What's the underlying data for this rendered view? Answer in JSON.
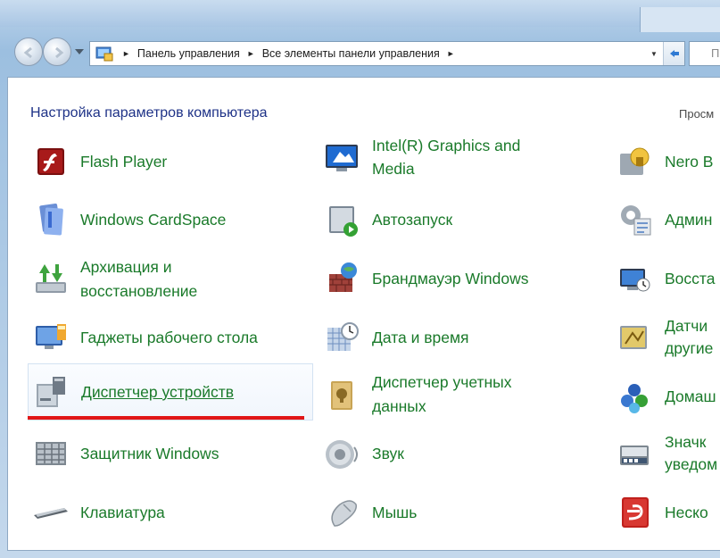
{
  "window": {
    "address": {
      "crumbs": [
        "Панель управления",
        "Все элементы панели управления"
      ],
      "search_placeholder": "П"
    }
  },
  "content": {
    "heading": "Настройка параметров компьютера",
    "view_label": "Просм"
  },
  "items": {
    "col1": [
      {
        "label": "Flash Player",
        "icon": "flash-icon"
      },
      {
        "label": "Windows CardSpace",
        "icon": "cardspace-icon"
      },
      {
        "label": "Архивация и\nвосстановление",
        "icon": "backup-icon"
      },
      {
        "label": "Гаджеты рабочего стола",
        "icon": "gadgets-icon"
      },
      {
        "label": "Диспетчер устройств",
        "icon": "device-manager-icon"
      },
      {
        "label": "Защитник Windows",
        "icon": "defender-icon"
      },
      {
        "label": "Клавиатура",
        "icon": "keyboard-icon"
      }
    ],
    "col2": [
      {
        "label": "Intel(R) Graphics and\nMedia",
        "icon": "intel-graphics-icon"
      },
      {
        "label": "Автозапуск",
        "icon": "autoplay-icon"
      },
      {
        "label": "Брандмауэр Windows",
        "icon": "firewall-icon"
      },
      {
        "label": "Дата и время",
        "icon": "datetime-icon"
      },
      {
        "label": "Диспетчер учетных\nданных",
        "icon": "credential-manager-icon"
      },
      {
        "label": "Звук",
        "icon": "sound-icon"
      },
      {
        "label": "Мышь",
        "icon": "mouse-icon"
      }
    ],
    "col3": [
      {
        "label": "Nero B",
        "icon": "nero-icon"
      },
      {
        "label": "Админ",
        "icon": "admin-tools-icon"
      },
      {
        "label": "Восста",
        "icon": "recovery-icon"
      },
      {
        "label": "Датчи\nдругие",
        "icon": "sensors-icon"
      },
      {
        "label": "Домаш",
        "icon": "homegroup-icon"
      },
      {
        "label": "Значк\nуведом",
        "icon": "notification-icons-icon"
      },
      {
        "label": "Неско",
        "icon": "fonts-icon"
      }
    ]
  },
  "colors": {
    "link_green": "#1a7a2a",
    "heading_blue": "#1e3287",
    "highlight_red": "#e11616"
  }
}
